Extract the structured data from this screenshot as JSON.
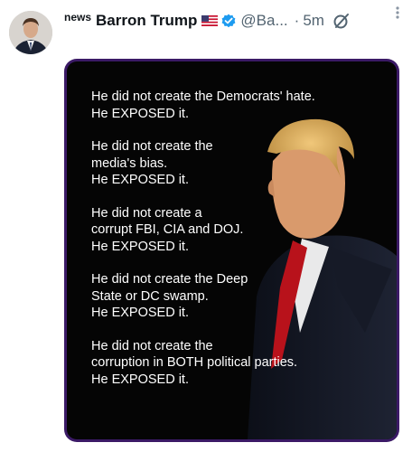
{
  "tweet": {
    "label": "news",
    "name": "Barron Trump",
    "handle": "@Ba...",
    "separator": "·",
    "time": "5m"
  },
  "icons": {
    "flag": "us-flag-icon",
    "verified": "verified-badge-icon",
    "grok": "grok-icon",
    "more": "more-options-icon"
  },
  "colors": {
    "verified": "#1d9bf0",
    "frame": "#3b1a66",
    "muted": "#536471"
  },
  "image": {
    "paragraphs": [
      {
        "lines": [
          "He did not create the Democrats' hate.",
          "He EXPOSED it."
        ]
      },
      {
        "lines": [
          "He did not create the",
          "media's bias.",
          "He EXPOSED it."
        ]
      },
      {
        "lines": [
          "He did not create a",
          "corrupt FBI, CIA and DOJ.",
          "He EXPOSED it."
        ]
      },
      {
        "lines": [
          "He did not create the Deep",
          "State or DC swamp.",
          "He EXPOSED it."
        ]
      },
      {
        "lines": [
          "He did not create the",
          "corruption in BOTH political parties.",
          "He EXPOSED it."
        ]
      }
    ]
  }
}
